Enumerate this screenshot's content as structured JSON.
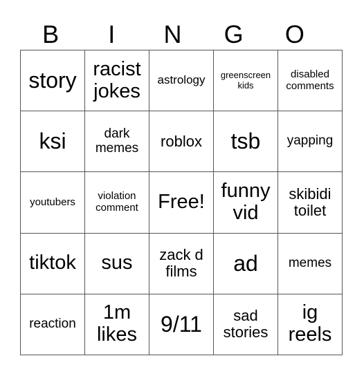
{
  "header": [
    "B",
    "I",
    "N",
    "G",
    "O"
  ],
  "cells": [
    [
      "story",
      "racist jokes",
      "astrology",
      "greenscreen kids",
      "disabled comments"
    ],
    [
      "ksi",
      "dark memes",
      "roblox",
      "tsb",
      "yapping"
    ],
    [
      "youtubers",
      "violation comment",
      "Free!",
      "funny vid",
      "skibidi toilet"
    ],
    [
      "tiktok",
      "sus",
      "zack d films",
      "ad",
      "memes"
    ],
    [
      "reaction",
      "1m likes",
      "9/11",
      "sad stories",
      "ig reels"
    ]
  ]
}
